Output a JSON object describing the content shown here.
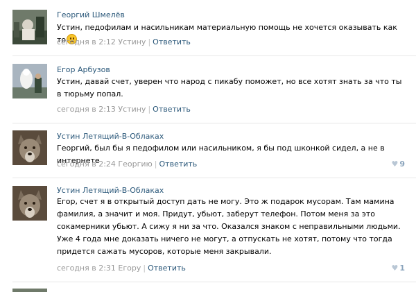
{
  "comments": [
    {
      "author": "Георгий Шмелёв",
      "text": "Устин, педофилам и насильникам материальную помощь не хочется оказывать как то",
      "emoji": "smiley-emoji",
      "timestamp": "сегодня в 2:12 Устину",
      "reply": "Ответить",
      "likes": null
    },
    {
      "author": "Егор Арбузов",
      "text": "Устин, давай счет, уверен что народ с пикабу поможет, но все хотят знать за что ты в тюрьму попал.",
      "timestamp": "сегодня в 2:13 Устину",
      "reply": "Ответить",
      "likes": null
    },
    {
      "author": "Устин Летящий-В-Облаках",
      "text": "Георгий, был бы я педофилом или насильником, я бы под шконкой сидел, а не в интернете",
      "timestamp": "сегодня в 2:24 Георгию",
      "reply": "Ответить",
      "likes": "9"
    },
    {
      "author": "Устин Летящий-В-Облаках",
      "text": "Егор, счет я в открытый доступ дать не могу. Это ж подарок мусорам. Там мамина фамилия, а значит и моя. Придут, убьют, заберут телефон. Потом меня за это сокамерники убьют. А сижу я ни за что. Оказался знаком с неправильными людьми. Уже 4 года мне доказать ничего не могут, а отпускать не хотят, потому что тогда придется сажать мусоров, которые меня закрывали.",
      "timestamp": "сегодня в 2:31 Егору",
      "reply": "Ответить",
      "likes": "1"
    }
  ],
  "colors": {
    "link": "#2b587a",
    "meta": "#999999",
    "like": "#8aa4bc",
    "divider": "#e7e7e7"
  }
}
